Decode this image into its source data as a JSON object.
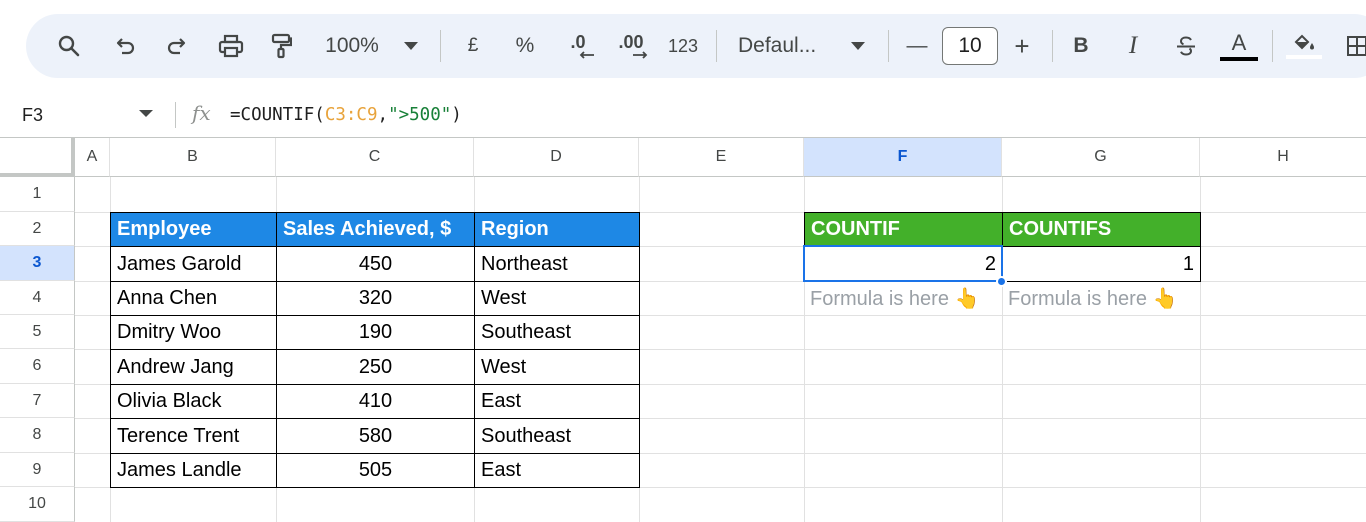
{
  "toolbar": {
    "zoom": "100%",
    "currency_label": "£",
    "percent_label": "%",
    "decrease_decimal_label": ".0",
    "increase_decimal_label": ".00",
    "format_number_label": "123",
    "font_family": "Defaul...",
    "font_size": "10",
    "minus_label": "—",
    "plus_label": "+",
    "bold_label": "B",
    "italic_label": "I",
    "text_color_label": "A"
  },
  "formula_bar": {
    "cell_ref": "F3",
    "fx": "fx",
    "formula_prefix": "=COUNTIF(",
    "formula_range": "C3:C9",
    "formula_comma": ",",
    "formula_string": "\">500\"",
    "formula_suffix": ")"
  },
  "columns": [
    "A",
    "B",
    "C",
    "D",
    "E",
    "F",
    "G",
    "H"
  ],
  "rows": [
    "1",
    "2",
    "3",
    "4",
    "5",
    "6",
    "7",
    "8",
    "9",
    "10"
  ],
  "selected": {
    "column": "F",
    "row": "3"
  },
  "table": {
    "headers": [
      "Employee",
      "Sales Achieved, $",
      "Region"
    ],
    "rows": [
      [
        "James Garold",
        "450",
        "Northeast"
      ],
      [
        "Anna Chen",
        "320",
        "West"
      ],
      [
        "Dmitry Woo",
        "190",
        "Southeast"
      ],
      [
        "Andrew Jang",
        "250",
        "West"
      ],
      [
        "Olivia Black",
        "410",
        "East"
      ],
      [
        "Terence Trent",
        "580",
        "Southeast"
      ],
      [
        "James Landle",
        "505",
        "East"
      ]
    ]
  },
  "summary": {
    "countif_header": "COUNTIF",
    "countifs_header": "COUNTIFS",
    "countif_value": "2",
    "countifs_value": "1",
    "countif_note": "Formula is here 👆",
    "countifs_note": "Formula is here 👆"
  },
  "colors": {
    "header_blue": "#1e88e5",
    "header_green": "#43b02a",
    "selection_blue": "#1a73e8",
    "toolbar_bg": "#edf2fa"
  },
  "icons": [
    "search-icon",
    "undo-icon",
    "redo-icon",
    "print-icon",
    "paint-format-icon",
    "dropdown-caret-icon",
    "strikethrough-icon",
    "fill-color-icon",
    "borders-icon"
  ]
}
